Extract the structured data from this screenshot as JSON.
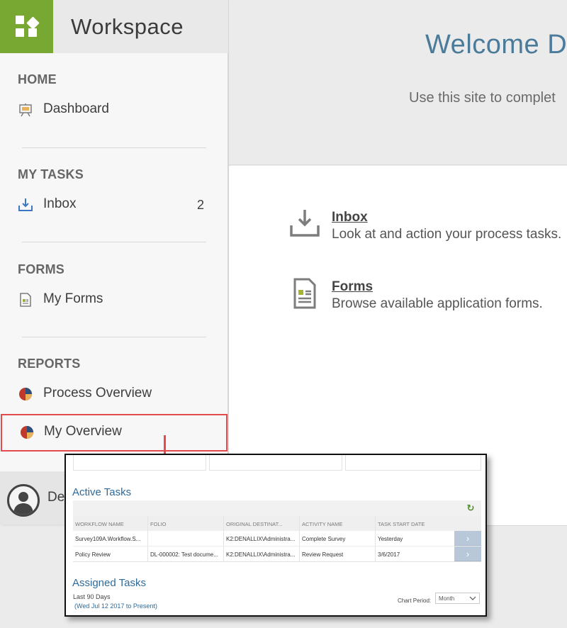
{
  "brand": {
    "title": "Workspace",
    "color": "#78a832"
  },
  "nav": {
    "sections": [
      {
        "heading": "HOME",
        "items": [
          {
            "label": "Dashboard",
            "icon": "presentation-board-icon"
          }
        ]
      },
      {
        "heading": "MY TASKS",
        "items": [
          {
            "label": "Inbox",
            "icon": "inbox-download-icon",
            "count": "2"
          }
        ]
      },
      {
        "heading": "FORMS",
        "items": [
          {
            "label": "My Forms",
            "icon": "form-document-icon"
          }
        ]
      },
      {
        "heading": "REPORTS",
        "items": [
          {
            "label": "Process Overview",
            "icon": "pie-chart-icon"
          },
          {
            "label": "My Overview",
            "icon": "pie-chart-icon",
            "selected": true
          }
        ]
      }
    ]
  },
  "user": {
    "name_partial": "De"
  },
  "main": {
    "welcome": "Welcome De",
    "subtitle": "Use this site to complet",
    "tiles": [
      {
        "title": "Inbox",
        "description": "Look at and action your process tasks.",
        "icon": "inbox-tray-icon"
      },
      {
        "title": "Forms",
        "description": "Browse available application forms.",
        "icon": "forms-icon"
      }
    ]
  },
  "inset": {
    "active_title": "Active Tasks",
    "columns": [
      "WORKFLOW NAME",
      "FOLIO",
      "ORIGINAL DESTINAT...",
      "ACTIVITY NAME",
      "TASK START DATE"
    ],
    "rows": [
      [
        "Survey109A.Workflow.S...",
        "",
        "K2:DENALLIX\\Administra...",
        "Complete Survey",
        "Yesterday"
      ],
      [
        "Policy Review",
        "DL-000002: Test docume...",
        "K2:DENALLIX\\Administra...",
        "Review Request",
        "3/6/2017"
      ]
    ],
    "assigned_title": "Assigned Tasks",
    "last_days": "Last 90 Days",
    "date_range": "(Wed Jul 12 2017 to Present)",
    "period_label": "Chart Period:",
    "period_value": "Month"
  },
  "colors": {
    "accent_blue": "#4b7b9a",
    "highlight_red": "#e34b4f"
  }
}
